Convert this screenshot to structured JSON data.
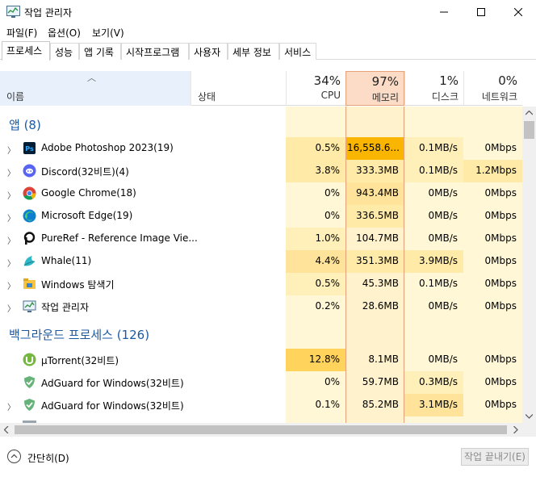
{
  "window": {
    "title": "작업 관리자"
  },
  "menu": [
    "파일(F)",
    "옵션(O)",
    "보기(V)"
  ],
  "tabs": [
    "프로세스",
    "성능",
    "앱 기록",
    "시작프로그램",
    "사용자",
    "세부 정보",
    "서비스"
  ],
  "columns": {
    "name": "이름",
    "status": "상태",
    "cpu": {
      "pct": "34%",
      "label": "CPU"
    },
    "memory": {
      "pct": "97%",
      "label": "메모리"
    },
    "disk": {
      "pct": "1%",
      "label": "디스크"
    },
    "network": {
      "pct": "0%",
      "label": "네트워크"
    }
  },
  "groups": {
    "apps": "앱 (8)",
    "background": "백그라운드 프로세스 (126)"
  },
  "apps": [
    {
      "name": "Adobe Photoshop 2023(19)",
      "cpu": "0.5%",
      "mem": "16,558.6...",
      "disk": "0.1MB/s",
      "net": "0Mbps",
      "icon": "photoshop-icon"
    },
    {
      "name": "Discord(32비트)(4)",
      "cpu": "3.8%",
      "mem": "333.3MB",
      "disk": "0.1MB/s",
      "net": "1.2Mbps",
      "icon": "discord-icon"
    },
    {
      "name": "Google Chrome(18)",
      "cpu": "0%",
      "mem": "943.4MB",
      "disk": "0MB/s",
      "net": "0Mbps",
      "icon": "chrome-icon"
    },
    {
      "name": "Microsoft Edge(19)",
      "cpu": "0%",
      "mem": "336.5MB",
      "disk": "0MB/s",
      "net": "0Mbps",
      "icon": "edge-icon"
    },
    {
      "name": "PureRef - Reference Image Vie...",
      "cpu": "1.0%",
      "mem": "104.7MB",
      "disk": "0MB/s",
      "net": "0Mbps",
      "icon": "pureref-icon"
    },
    {
      "name": "Whale(11)",
      "cpu": "4.4%",
      "mem": "351.3MB",
      "disk": "3.9MB/s",
      "net": "0Mbps",
      "icon": "whale-icon"
    },
    {
      "name": "Windows 탐색기",
      "cpu": "0.5%",
      "mem": "45.3MB",
      "disk": "0.1MB/s",
      "net": "0Mbps",
      "icon": "explorer-icon"
    },
    {
      "name": "작업 관리자",
      "cpu": "0.2%",
      "mem": "28.6MB",
      "disk": "0MB/s",
      "net": "0Mbps",
      "icon": "taskmgr-icon"
    }
  ],
  "background": [
    {
      "name": "µTorrent(32비트)",
      "cpu": "12.8%",
      "mem": "8.1MB",
      "disk": "0MB/s",
      "net": "0Mbps",
      "icon": "utorrent-icon"
    },
    {
      "name": "AdGuard for Windows(32비트)",
      "cpu": "0%",
      "mem": "59.7MB",
      "disk": "0.3MB/s",
      "net": "0Mbps",
      "icon": "adguard-icon"
    },
    {
      "name": "AdGuard for Windows(32비트)",
      "cpu": "0.1%",
      "mem": "85.2MB",
      "disk": "3.1MB/s",
      "net": "0Mbps",
      "icon": "adguard-icon"
    }
  ],
  "footer": {
    "collapse": "간단히(D)",
    "end_task": "작업 끝내기(E)"
  },
  "colors": {
    "accent_blue": "#1b5aa3",
    "heat_light": "#fff4c4",
    "heat_mid": "#ffe8a0",
    "heat_strong": "#ffd35c",
    "mem_header": "#fcdcc6",
    "mem_hot": "#f9b500"
  }
}
